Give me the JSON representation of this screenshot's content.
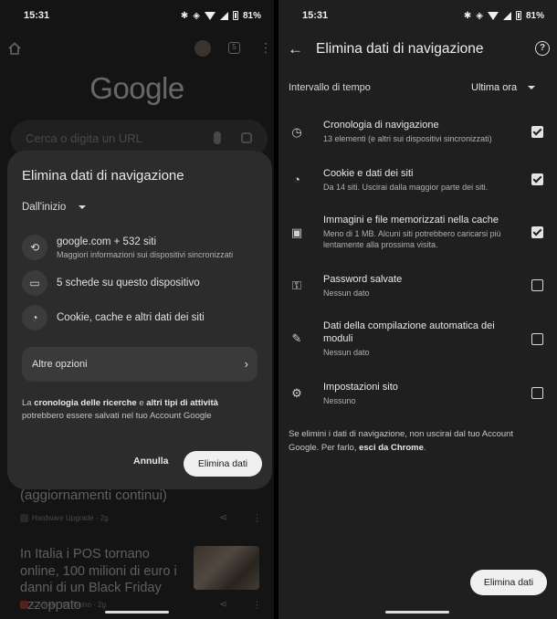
{
  "left": {
    "status": {
      "time": "15:31",
      "battery": "81%"
    },
    "google_logo": "Google",
    "search_placeholder": "Cerca o digita un URL",
    "tab_count": "5",
    "news": [
      {
        "title": "(aggiornamenti continui)",
        "source": "Hardware Upgrade · 2g"
      },
      {
        "title": "In Italia i POS tornano online, 100 milioni di euro i danni di un Black Friday azzoppato",
        "source": "Corriere del Ticino · 2g"
      }
    ],
    "dialog": {
      "title": "Elimina dati di navigazione",
      "range": "Dall'inizio",
      "items": [
        {
          "icon": "history-icon",
          "title": "google.com + 532 siti",
          "subtitle": "Maggiori informazioni sui dispositivi sincronizzati"
        },
        {
          "icon": "tab-icon",
          "title": "5 schede su questo dispositivo",
          "subtitle": ""
        },
        {
          "icon": "cookie-icon",
          "title": "Cookie, cache e altri dati dei siti",
          "subtitle": ""
        }
      ],
      "more_options": "Altre opzioni",
      "note": {
        "p1": "La ",
        "b1": "cronologia delle ricerche",
        "p2": " e ",
        "b2": "altri tipi di attività",
        "p3": " potrebbero essere salvati nel tuo Account Google"
      },
      "cancel": "Annulla",
      "confirm": "Elimina dati"
    }
  },
  "right": {
    "status": {
      "time": "15:31",
      "battery": "81%"
    },
    "title": "Elimina dati di navigazione",
    "interval_label": "Intervallo di tempo",
    "interval_value": "Ultima ora",
    "rows": [
      {
        "icon": "clock-icon",
        "title": "Cronologia di navigazione",
        "subtitle": "13 elementi (e altri sui dispositivi sincronizzati)",
        "checked": true
      },
      {
        "icon": "cookie-icon",
        "title": "Cookie e dati dei siti",
        "subtitle": "Da 14 siti. Uscirai dalla maggior parte dei siti.",
        "checked": true
      },
      {
        "icon": "image-icon",
        "title": "Immagini e file memorizzati nella cache",
        "subtitle": "Meno di 1 MB. Alcuni siti potrebbero caricarsi più lentamente alla prossima visita.",
        "checked": true
      },
      {
        "icon": "key-icon",
        "title": "Password salvate",
        "subtitle": "Nessun dato",
        "checked": false
      },
      {
        "icon": "pencil-icon",
        "title": "Dati della compilazione automatica dei moduli",
        "subtitle": "Nessun dato",
        "checked": false
      },
      {
        "icon": "site-settings-icon",
        "title": "Impostazioni sito",
        "subtitle": "Nessuno",
        "checked": false
      }
    ],
    "note": {
      "text": "Se elimini i dati di navigazione, non uscirai dal tuo Account Google. Per farlo, ",
      "link": "esci da Chrome",
      "end": "."
    },
    "confirm": "Elimina dati"
  }
}
